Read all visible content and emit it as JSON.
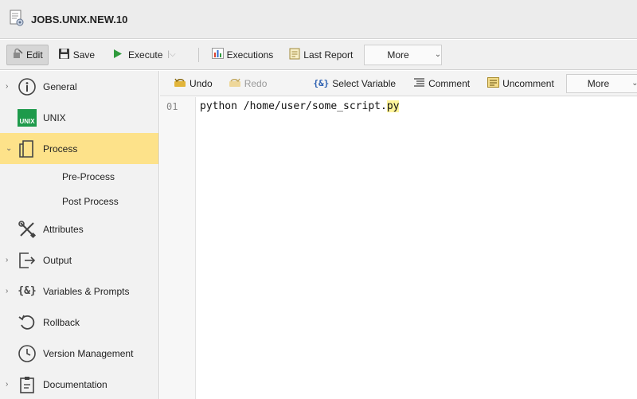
{
  "window": {
    "title": "JOBS.UNIX.NEW.10",
    "icon": "job-document-gear-icon"
  },
  "main_toolbar": {
    "edit_label": "Edit",
    "save_label": "Save",
    "execute_label": "Execute",
    "executions_label": "Executions",
    "last_report_label": "Last Report",
    "more_label": "More"
  },
  "sidebar": {
    "general": "General",
    "unix": "UNIX",
    "unix_badge": "UNIX",
    "process": "Process",
    "pre_process": "Pre-Process",
    "post_process": "Post Process",
    "attributes": "Attributes",
    "output": "Output",
    "variables": "Variables & Prompts",
    "variables_glyph": "{&}",
    "rollback": "Rollback",
    "version_management": "Version Management",
    "documentation": "Documentation"
  },
  "editor_toolbar": {
    "undo_label": "Undo",
    "redo_label": "Redo",
    "select_variable_label": "Select Variable",
    "select_variable_glyph": "{&}",
    "comment_label": "Comment",
    "uncomment_label": "Uncomment",
    "more_label": "More"
  },
  "editor": {
    "line_number": "01",
    "code_main": "python /home/user/some_script.",
    "code_highlight": "py"
  },
  "colors": {
    "active_nav": "#fde28a",
    "highlight": "#fff59a",
    "unix_badge": "#1e9a4b"
  }
}
